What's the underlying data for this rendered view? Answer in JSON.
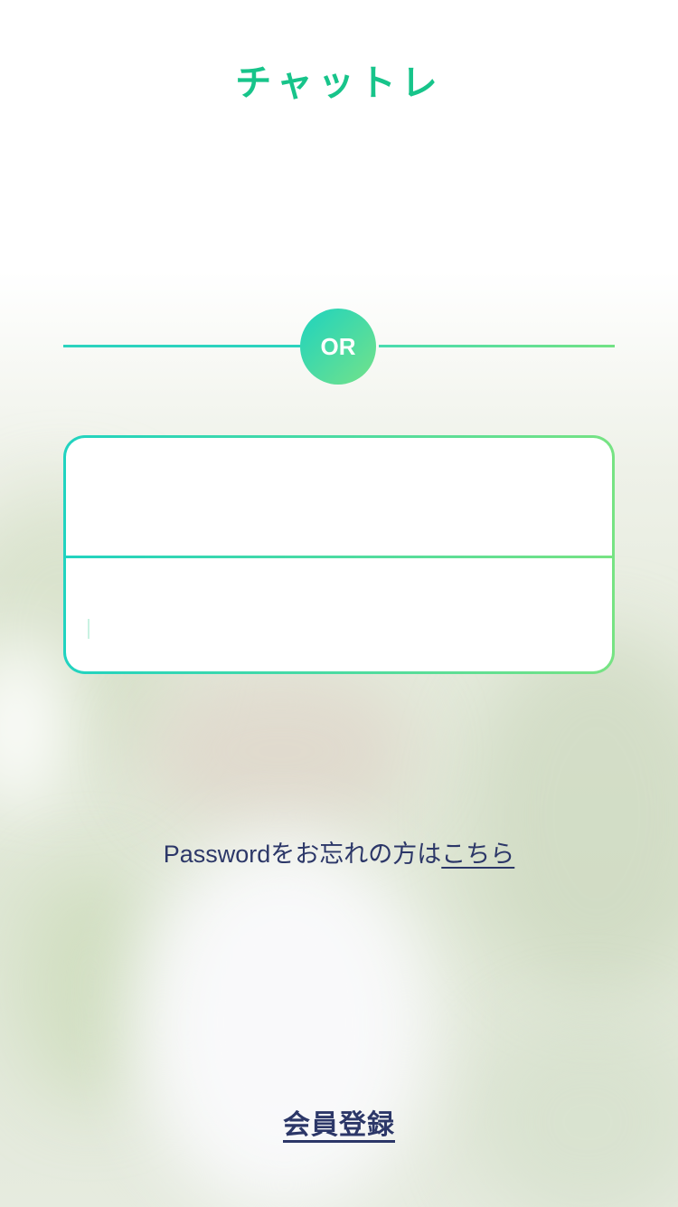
{
  "app": {
    "logo_text": "チャットレ"
  },
  "divider": {
    "or_label": "OR"
  },
  "login_form": {
    "id_field": {
      "value": "",
      "placeholder": ""
    },
    "password_field": {
      "value": "",
      "placeholder": ""
    }
  },
  "forgot_password": {
    "text": "Passwordをお忘れの方は",
    "link_label": "こちら"
  },
  "register": {
    "link_label": "会員登録"
  },
  "colors": {
    "brand_green": "#17c48a",
    "gradient_start": "#21d3c0",
    "gradient_end": "#77e383",
    "text_navy": "#2c3768"
  }
}
